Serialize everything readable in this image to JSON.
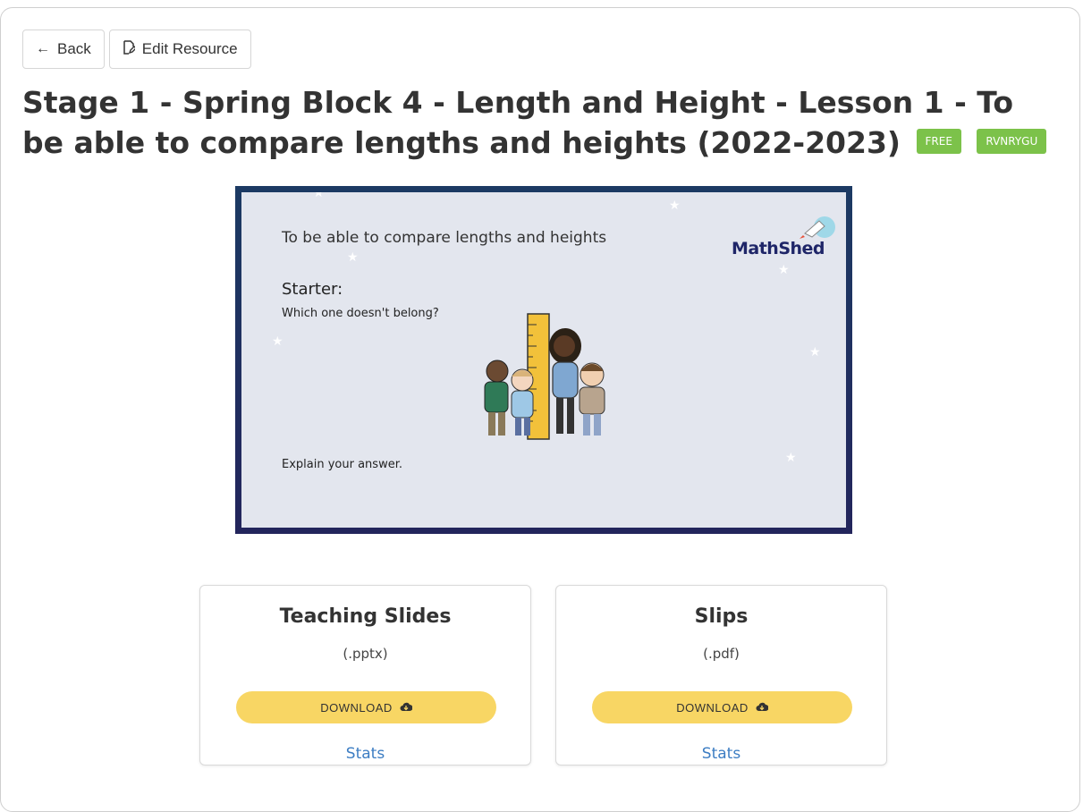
{
  "toolbar": {
    "back_label": "Back",
    "back_icon": "arrow-left-icon",
    "edit_label": "Edit Resource",
    "edit_icon": "edit-icon"
  },
  "page": {
    "title": "Stage 1 - Spring Block 4 - Length and Height - Lesson 1 - To be able to compare lengths and heights (2022-2023)",
    "badges": [
      "FREE",
      "RVNRYGU"
    ],
    "badge_color": "#7cc24a"
  },
  "preview": {
    "heading": "To be able to compare lengths and heights",
    "starter": "Starter:",
    "question": "Which one doesn't belong?",
    "explain": "Explain your answer.",
    "logo_text": "MathShed"
  },
  "resources": [
    {
      "title": "Teaching Slides",
      "ext": "(.pptx)",
      "download_label": "DOWNLOAD",
      "stats_label": "Stats"
    },
    {
      "title": "Slips",
      "ext": "(.pdf)",
      "download_label": "DOWNLOAD",
      "stats_label": "Stats"
    }
  ],
  "colors": {
    "download_button": "#f8d664",
    "link": "#3c7dc3",
    "slide_border": "#23255c"
  }
}
